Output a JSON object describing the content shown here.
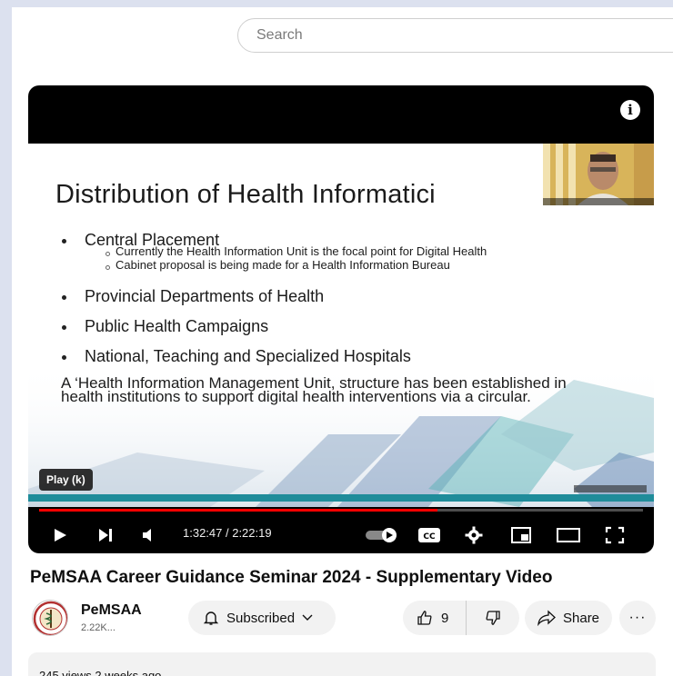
{
  "search": {
    "placeholder": "Search"
  },
  "player": {
    "tooltip": "Play (k)",
    "time": "1:32:47 / 2:22:19",
    "progress_fraction": 0.66,
    "slide": {
      "title": "Distribution of Health Informatici",
      "bullets": [
        {
          "text": "Central Placement",
          "sub": [
            "Currently the Health Information Unit is the focal point for Digital Health",
            "Cabinet proposal is being made for a Health Information Bureau"
          ]
        },
        {
          "text": "Provincial Departments of Health"
        },
        {
          "text": "Public Health Campaigns"
        },
        {
          "text": "National, Teaching and Specialized Hospitals"
        }
      ],
      "note": "A ‘Health Information Management Unit, structure has been established in health institutions to support digital health interventions via a circular."
    }
  },
  "video": {
    "title": "PeMSAA Career Guidance Seminar 2024 - Supplementary Video"
  },
  "channel": {
    "name": "PeMSAA",
    "subscribers": "2.22K..."
  },
  "actions": {
    "subscribed": "Subscribed",
    "like_count": "9",
    "share": "Share"
  },
  "description": {
    "meta": "245 views  2 weeks ago"
  },
  "colors": {
    "progress": "#ff0000",
    "page_bg": "#dce1ef"
  }
}
